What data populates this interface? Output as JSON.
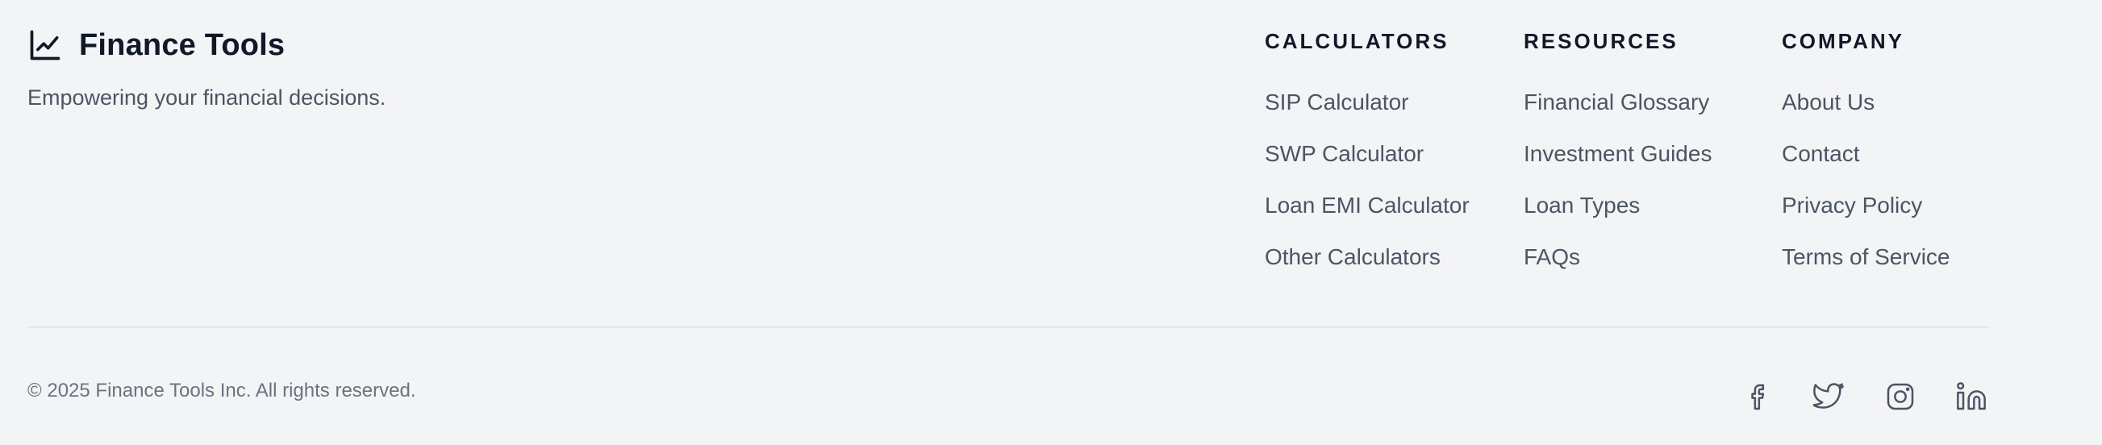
{
  "brand": {
    "title": "Finance Tools",
    "icon": "line-chart-icon",
    "tagline": "Empowering your financial decisions."
  },
  "columns": [
    {
      "title": "CALCULATORS",
      "links": [
        "SIP Calculator",
        "SWP Calculator",
        "Loan EMI Calculator",
        "Other Calculators"
      ]
    },
    {
      "title": "RESOURCES",
      "links": [
        "Financial Glossary",
        "Investment Guides",
        "Loan Types",
        "FAQs"
      ]
    },
    {
      "title": "COMPANY",
      "links": [
        "About Us",
        "Contact",
        "Privacy Policy",
        "Terms of Service"
      ]
    }
  ],
  "copyright": "© 2025 Finance Tools Inc. All rights reserved.",
  "socials": [
    {
      "name": "facebook-icon"
    },
    {
      "name": "twitter-icon"
    },
    {
      "name": "instagram-icon"
    },
    {
      "name": "linkedin-icon"
    }
  ],
  "colors": {
    "background": "#f3f4f6",
    "heading": "#111827",
    "text": "#4b5563",
    "muted": "#6b7280",
    "divider": "#e5e7eb"
  }
}
